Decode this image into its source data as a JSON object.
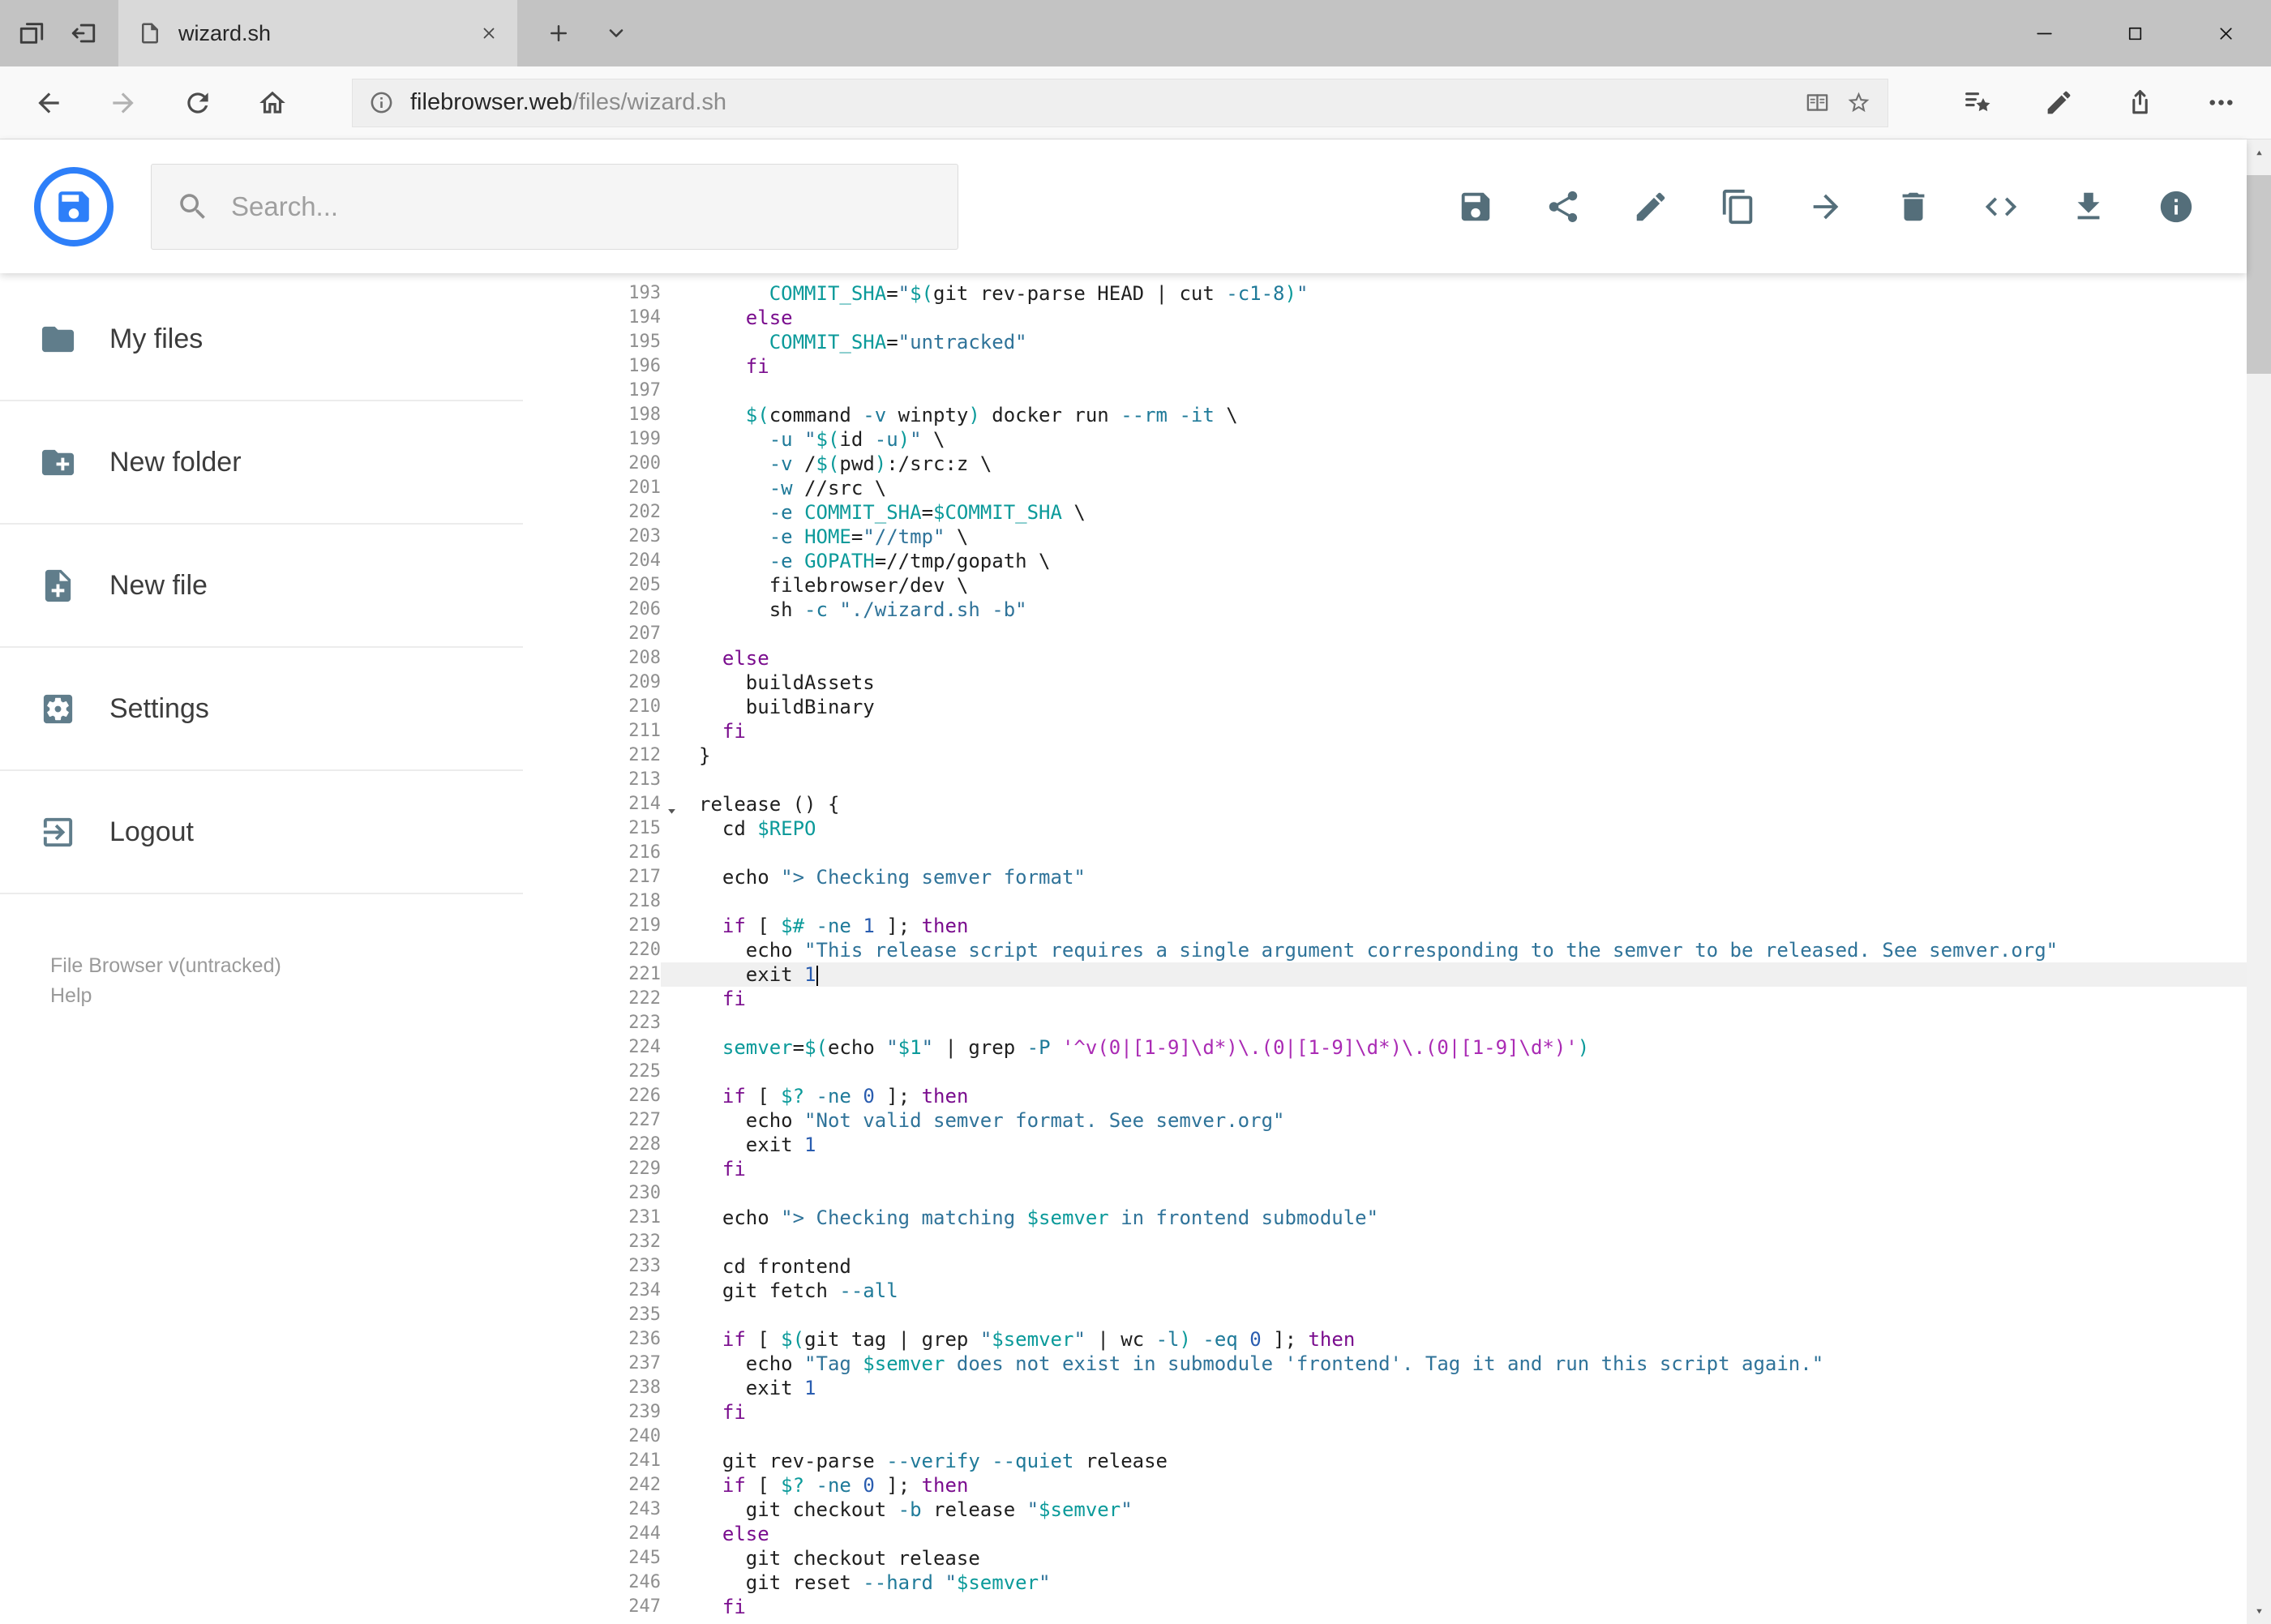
{
  "browser": {
    "tab_title": "wizard.sh",
    "url_host": "filebrowser.web",
    "url_path": "/files/wizard.sh",
    "nav_icons": [
      "back-icon",
      "forward-icon",
      "refresh-icon",
      "home-icon"
    ],
    "addressbar_icons": [
      "site-info-icon",
      "reading-view-icon",
      "favorite-star-icon"
    ],
    "menu_icons": [
      "hub-icon",
      "web-note-icon",
      "share-ext-icon",
      "more-icon"
    ],
    "window_control_icons": [
      "win-min-icon",
      "win-max-icon",
      "win-close-icon"
    ]
  },
  "app": {
    "search_placeholder": "Search...",
    "toolbar": [
      {
        "name": "save",
        "icon": "save-icon"
      },
      {
        "name": "share",
        "icon": "share-nodes-icon"
      },
      {
        "name": "rename",
        "icon": "pencil-icon"
      },
      {
        "name": "copy",
        "icon": "copy-icon"
      },
      {
        "name": "move",
        "icon": "move-arrow-icon"
      },
      {
        "name": "delete",
        "icon": "trash-icon"
      },
      {
        "name": "source",
        "icon": "code-icon"
      },
      {
        "name": "download",
        "icon": "download-icon"
      },
      {
        "name": "info",
        "icon": "info-icon"
      }
    ],
    "sidebar": {
      "items": [
        {
          "label": "My files",
          "icon": "folder-icon"
        },
        {
          "label": "New folder",
          "icon": "new-folder-icon"
        },
        {
          "label": "New file",
          "icon": "new-file-icon"
        },
        {
          "label": "Settings",
          "icon": "settings-icon"
        },
        {
          "label": "Logout",
          "icon": "logout-icon"
        }
      ],
      "footer_version": "File Browser v(untracked)",
      "footer_help": "Help"
    }
  },
  "colors": {
    "accent_blue": "#2d7ff9",
    "toolbar_icon": "#546e7a",
    "sidebar_icon": "#607d8b",
    "token_plain": "#1f1f1f",
    "token_keyword": "#7a0d8e",
    "token_string": "#2f7399",
    "token_string_alt": "#aa2bb4",
    "token_variable": "#0b9a9a",
    "token_flag": "#1f7a99",
    "token_number": "#2a5db0",
    "line_number": "#8f8f8f",
    "active_line_bg": "#f0f0f0"
  },
  "editor": {
    "active_line": 221,
    "fold_line": 214,
    "first_line": 193,
    "last_line": 247,
    "lines": [
      {
        "n": 193,
        "t": [
          [
            "pl",
            "      "
          ],
          [
            "var",
            "COMMIT_SHA"
          ],
          [
            "pl",
            "="
          ],
          [
            "str",
            "\""
          ],
          [
            "var",
            "$("
          ],
          [
            "pl",
            "git rev-parse HEAD | cut "
          ],
          [
            "flag",
            "-c1-8"
          ],
          [
            "var",
            ")"
          ],
          [
            "str",
            "\""
          ]
        ]
      },
      {
        "n": 194,
        "t": [
          [
            "pl",
            "    "
          ],
          [
            "kw",
            "else"
          ]
        ]
      },
      {
        "n": 195,
        "t": [
          [
            "pl",
            "      "
          ],
          [
            "var",
            "COMMIT_SHA"
          ],
          [
            "pl",
            "="
          ],
          [
            "str",
            "\"untracked\""
          ]
        ]
      },
      {
        "n": 196,
        "t": [
          [
            "pl",
            "    "
          ],
          [
            "kw",
            "fi"
          ]
        ]
      },
      {
        "n": 197,
        "t": []
      },
      {
        "n": 198,
        "t": [
          [
            "pl",
            "    "
          ],
          [
            "var",
            "$("
          ],
          [
            "pl",
            "command "
          ],
          [
            "flag",
            "-v"
          ],
          [
            "pl",
            " winpty"
          ],
          [
            "var",
            ")"
          ],
          [
            "pl",
            " docker run "
          ],
          [
            "flag",
            "--rm"
          ],
          [
            "pl",
            " "
          ],
          [
            "flag",
            "-it"
          ],
          [
            "pl",
            " \\"
          ]
        ]
      },
      {
        "n": 199,
        "t": [
          [
            "pl",
            "      "
          ],
          [
            "flag",
            "-u"
          ],
          [
            "pl",
            " "
          ],
          [
            "str",
            "\""
          ],
          [
            "var",
            "$("
          ],
          [
            "pl",
            "id "
          ],
          [
            "flag",
            "-u"
          ],
          [
            "var",
            ")"
          ],
          [
            "str",
            "\""
          ],
          [
            "pl",
            " \\"
          ]
        ]
      },
      {
        "n": 200,
        "t": [
          [
            "pl",
            "      "
          ],
          [
            "flag",
            "-v"
          ],
          [
            "pl",
            " /"
          ],
          [
            "var",
            "$("
          ],
          [
            "pl",
            "pwd"
          ],
          [
            "var",
            ")"
          ],
          [
            "pl",
            ":/src:z \\"
          ]
        ]
      },
      {
        "n": 201,
        "t": [
          [
            "pl",
            "      "
          ],
          [
            "flag",
            "-w"
          ],
          [
            "pl",
            " //src \\"
          ]
        ]
      },
      {
        "n": 202,
        "t": [
          [
            "pl",
            "      "
          ],
          [
            "flag",
            "-e"
          ],
          [
            "pl",
            " "
          ],
          [
            "var",
            "COMMIT_SHA"
          ],
          [
            "pl",
            "="
          ],
          [
            "var",
            "$COMMIT_SHA"
          ],
          [
            "pl",
            " \\"
          ]
        ]
      },
      {
        "n": 203,
        "t": [
          [
            "pl",
            "      "
          ],
          [
            "flag",
            "-e"
          ],
          [
            "pl",
            " "
          ],
          [
            "var",
            "HOME"
          ],
          [
            "pl",
            "="
          ],
          [
            "str",
            "\"//tmp\""
          ],
          [
            "pl",
            " \\"
          ]
        ]
      },
      {
        "n": 204,
        "t": [
          [
            "pl",
            "      "
          ],
          [
            "flag",
            "-e"
          ],
          [
            "pl",
            " "
          ],
          [
            "var",
            "GOPATH"
          ],
          [
            "pl",
            "=//tmp/gopath \\"
          ]
        ]
      },
      {
        "n": 205,
        "t": [
          [
            "pl",
            "      filebrowser/dev \\"
          ]
        ]
      },
      {
        "n": 206,
        "t": [
          [
            "pl",
            "      sh "
          ],
          [
            "flag",
            "-c"
          ],
          [
            "pl",
            " "
          ],
          [
            "str",
            "\"./wizard.sh -b\""
          ]
        ]
      },
      {
        "n": 207,
        "t": []
      },
      {
        "n": 208,
        "t": [
          [
            "pl",
            "  "
          ],
          [
            "kw",
            "else"
          ]
        ]
      },
      {
        "n": 209,
        "t": [
          [
            "pl",
            "    buildAssets"
          ]
        ]
      },
      {
        "n": 210,
        "t": [
          [
            "pl",
            "    buildBinary"
          ]
        ]
      },
      {
        "n": 211,
        "t": [
          [
            "pl",
            "  "
          ],
          [
            "kw",
            "fi"
          ]
        ]
      },
      {
        "n": 212,
        "t": [
          [
            "pl",
            "}"
          ]
        ]
      },
      {
        "n": 213,
        "t": []
      },
      {
        "n": 214,
        "t": [
          [
            "pl",
            "release () {"
          ]
        ]
      },
      {
        "n": 215,
        "t": [
          [
            "pl",
            "  cd "
          ],
          [
            "var",
            "$REPO"
          ]
        ]
      },
      {
        "n": 216,
        "t": []
      },
      {
        "n": 217,
        "t": [
          [
            "pl",
            "  echo "
          ],
          [
            "str",
            "\"> Checking semver format\""
          ]
        ]
      },
      {
        "n": 218,
        "t": []
      },
      {
        "n": 219,
        "t": [
          [
            "pl",
            "  "
          ],
          [
            "kw",
            "if"
          ],
          [
            "pl",
            " [ "
          ],
          [
            "var",
            "$#"
          ],
          [
            "pl",
            " "
          ],
          [
            "flag",
            "-ne"
          ],
          [
            "pl",
            " "
          ],
          [
            "num",
            "1"
          ],
          [
            "pl",
            " ]; "
          ],
          [
            "kw",
            "then"
          ]
        ]
      },
      {
        "n": 220,
        "t": [
          [
            "pl",
            "    echo "
          ],
          [
            "str",
            "\"This release script requires a single argument corresponding to the semver to be released. See semver.org\""
          ]
        ]
      },
      {
        "n": 221,
        "t": [
          [
            "pl",
            "    exit "
          ],
          [
            "num",
            "1"
          ]
        ]
      },
      {
        "n": 222,
        "t": [
          [
            "pl",
            "  "
          ],
          [
            "kw",
            "fi"
          ]
        ]
      },
      {
        "n": 223,
        "t": []
      },
      {
        "n": 224,
        "t": [
          [
            "pl",
            "  "
          ],
          [
            "var",
            "semver"
          ],
          [
            "pl",
            "="
          ],
          [
            "var",
            "$("
          ],
          [
            "pl",
            "echo "
          ],
          [
            "str",
            "\""
          ],
          [
            "var",
            "$1"
          ],
          [
            "str",
            "\""
          ],
          [
            "pl",
            " | grep "
          ],
          [
            "flag",
            "-P"
          ],
          [
            "pl",
            " "
          ],
          [
            "str2",
            "'^v(0|[1-9]\\d*)\\.(0|[1-9]\\d*)\\.(0|[1-9]\\d*)'"
          ],
          [
            "var",
            ")"
          ]
        ]
      },
      {
        "n": 225,
        "t": []
      },
      {
        "n": 226,
        "t": [
          [
            "pl",
            "  "
          ],
          [
            "kw",
            "if"
          ],
          [
            "pl",
            " [ "
          ],
          [
            "var",
            "$?"
          ],
          [
            "pl",
            " "
          ],
          [
            "flag",
            "-ne"
          ],
          [
            "pl",
            " "
          ],
          [
            "num",
            "0"
          ],
          [
            "pl",
            " ]; "
          ],
          [
            "kw",
            "then"
          ]
        ]
      },
      {
        "n": 227,
        "t": [
          [
            "pl",
            "    echo "
          ],
          [
            "str",
            "\"Not valid semver format. See semver.org\""
          ]
        ]
      },
      {
        "n": 228,
        "t": [
          [
            "pl",
            "    exit "
          ],
          [
            "num",
            "1"
          ]
        ]
      },
      {
        "n": 229,
        "t": [
          [
            "pl",
            "  "
          ],
          [
            "kw",
            "fi"
          ]
        ]
      },
      {
        "n": 230,
        "t": []
      },
      {
        "n": 231,
        "t": [
          [
            "pl",
            "  echo "
          ],
          [
            "str",
            "\"> Checking matching "
          ],
          [
            "var",
            "$semver"
          ],
          [
            "str",
            " in frontend submodule\""
          ]
        ]
      },
      {
        "n": 232,
        "t": []
      },
      {
        "n": 233,
        "t": [
          [
            "pl",
            "  cd frontend"
          ]
        ]
      },
      {
        "n": 234,
        "t": [
          [
            "pl",
            "  git fetch "
          ],
          [
            "flag",
            "--all"
          ]
        ]
      },
      {
        "n": 235,
        "t": []
      },
      {
        "n": 236,
        "t": [
          [
            "pl",
            "  "
          ],
          [
            "kw",
            "if"
          ],
          [
            "pl",
            " [ "
          ],
          [
            "var",
            "$("
          ],
          [
            "pl",
            "git tag | grep "
          ],
          [
            "str",
            "\""
          ],
          [
            "var",
            "$semver"
          ],
          [
            "str",
            "\""
          ],
          [
            "pl",
            " | wc "
          ],
          [
            "flag",
            "-l"
          ],
          [
            "var",
            ")"
          ],
          [
            "pl",
            " "
          ],
          [
            "flag",
            "-eq"
          ],
          [
            "pl",
            " "
          ],
          [
            "num",
            "0"
          ],
          [
            "pl",
            " ]; "
          ],
          [
            "kw",
            "then"
          ]
        ]
      },
      {
        "n": 237,
        "t": [
          [
            "pl",
            "    echo "
          ],
          [
            "str",
            "\"Tag "
          ],
          [
            "var",
            "$semver"
          ],
          [
            "str",
            " does not exist in submodule 'frontend'. Tag it and run this script again.\""
          ]
        ]
      },
      {
        "n": 238,
        "t": [
          [
            "pl",
            "    exit "
          ],
          [
            "num",
            "1"
          ]
        ]
      },
      {
        "n": 239,
        "t": [
          [
            "pl",
            "  "
          ],
          [
            "kw",
            "fi"
          ]
        ]
      },
      {
        "n": 240,
        "t": []
      },
      {
        "n": 241,
        "t": [
          [
            "pl",
            "  git rev-parse "
          ],
          [
            "flag",
            "--verify"
          ],
          [
            "pl",
            " "
          ],
          [
            "flag",
            "--quiet"
          ],
          [
            "pl",
            " release"
          ]
        ]
      },
      {
        "n": 242,
        "t": [
          [
            "pl",
            "  "
          ],
          [
            "kw",
            "if"
          ],
          [
            "pl",
            " [ "
          ],
          [
            "var",
            "$?"
          ],
          [
            "pl",
            " "
          ],
          [
            "flag",
            "-ne"
          ],
          [
            "pl",
            " "
          ],
          [
            "num",
            "0"
          ],
          [
            "pl",
            " ]; "
          ],
          [
            "kw",
            "then"
          ]
        ]
      },
      {
        "n": 243,
        "t": [
          [
            "pl",
            "    git checkout "
          ],
          [
            "flag",
            "-b"
          ],
          [
            "pl",
            " release "
          ],
          [
            "str",
            "\""
          ],
          [
            "var",
            "$semver"
          ],
          [
            "str",
            "\""
          ]
        ]
      },
      {
        "n": 244,
        "t": [
          [
            "pl",
            "  "
          ],
          [
            "kw",
            "else"
          ]
        ]
      },
      {
        "n": 245,
        "t": [
          [
            "pl",
            "    git checkout release"
          ]
        ]
      },
      {
        "n": 246,
        "t": [
          [
            "pl",
            "    git reset "
          ],
          [
            "flag",
            "--hard"
          ],
          [
            "pl",
            " "
          ],
          [
            "str",
            "\""
          ],
          [
            "var",
            "$semver"
          ],
          [
            "str",
            "\""
          ]
        ]
      },
      {
        "n": 247,
        "t": [
          [
            "pl",
            "  "
          ],
          [
            "kw",
            "fi"
          ]
        ]
      }
    ]
  }
}
